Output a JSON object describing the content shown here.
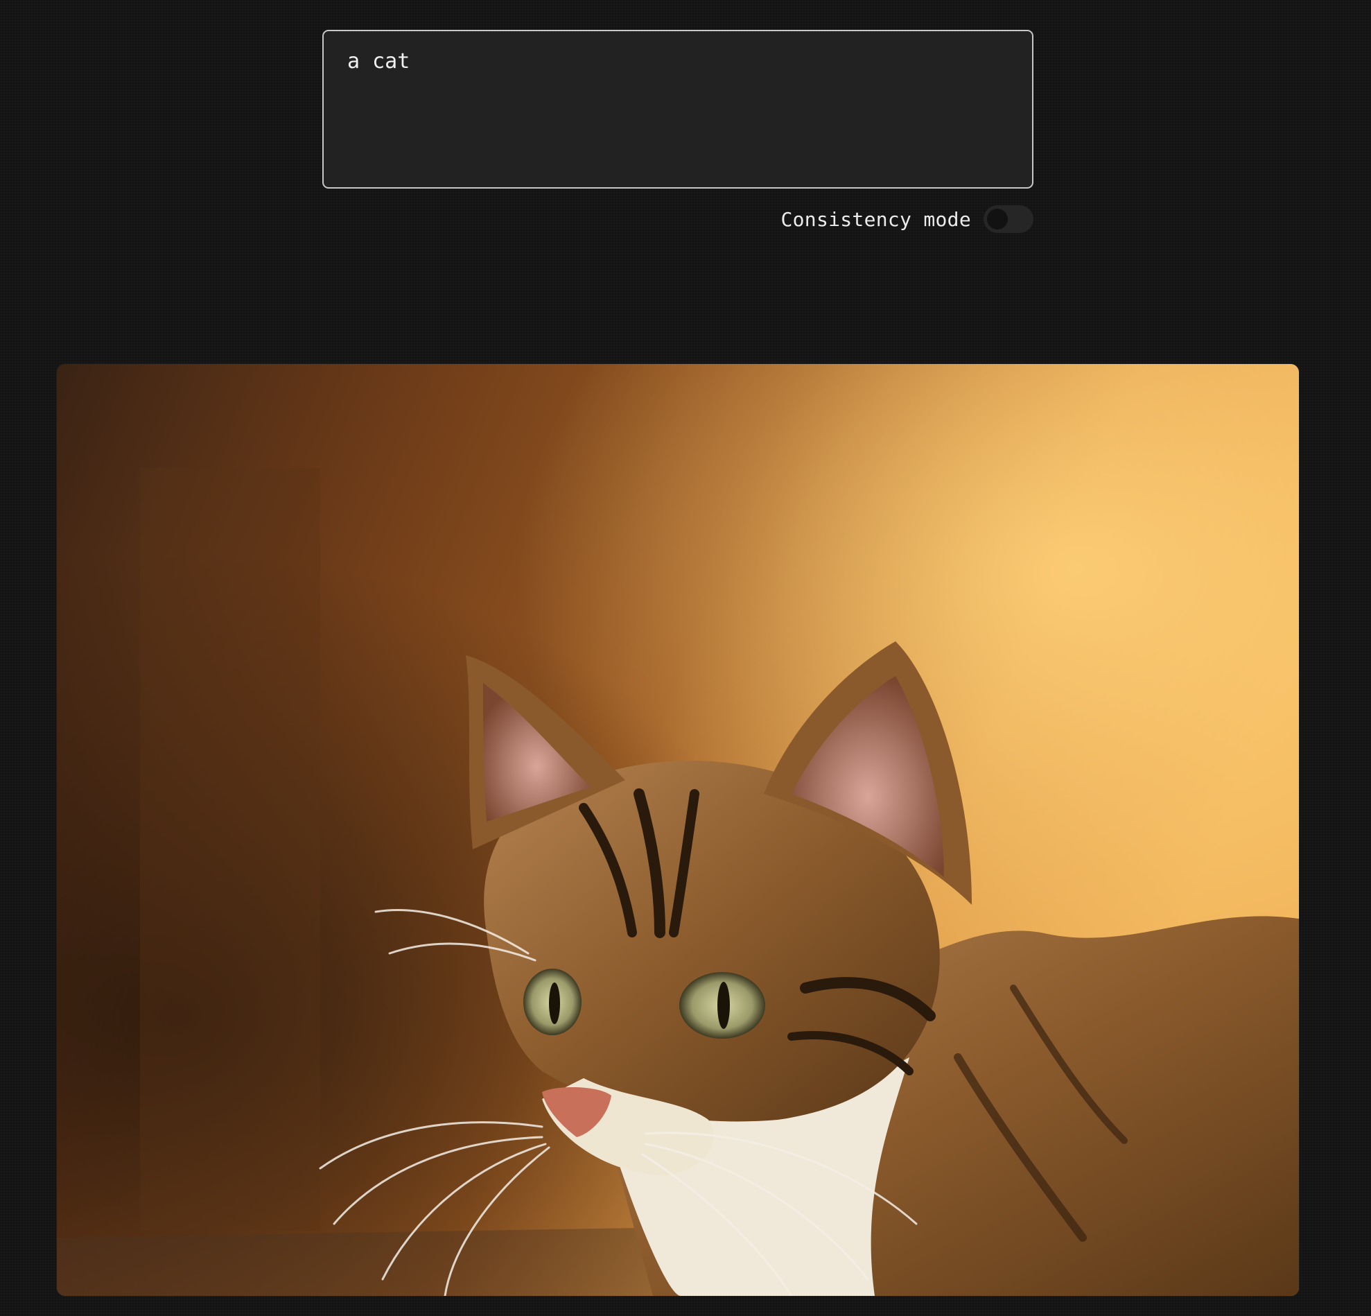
{
  "prompt": {
    "value": "a cat"
  },
  "consistency": {
    "label": "Consistency mode",
    "enabled": false
  },
  "result": {
    "subject": "tabby cat portrait"
  },
  "colors": {
    "page_background": "#141414",
    "input_background": "#222222",
    "input_border": "#c8c8c8",
    "toggle_off": "#262626"
  }
}
